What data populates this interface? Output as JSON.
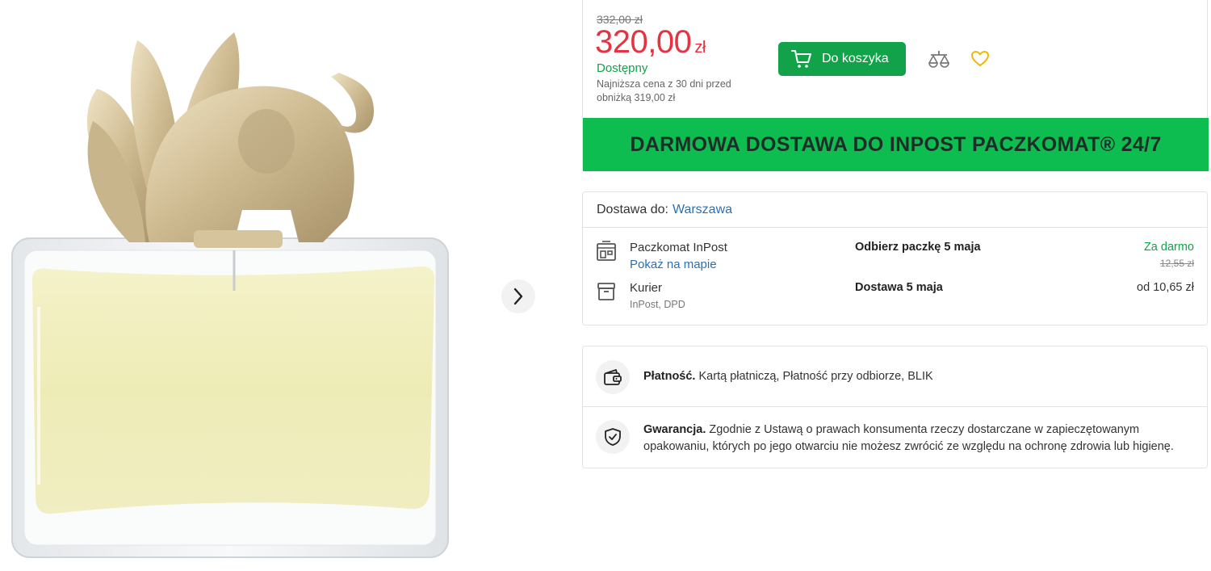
{
  "gallery": {
    "next_icon": "chevron-right-icon",
    "image_alt": "Kenzo Jungle L'Elephant perfume bottle"
  },
  "price": {
    "old_price": "332,00 zł",
    "current_value": "320,00",
    "currency": "zł",
    "availability": "Dostępny",
    "lowest_price_note": "Najniższa cena z 30 dni przed obniżką 319,00 zł",
    "colors": {
      "price": "#e63241",
      "accent": "#12a34a"
    }
  },
  "actions": {
    "cart_label": "Do koszyka",
    "cart_icon": "cart-icon",
    "compare_icon": "compare-icon",
    "favorite_icon": "heart-icon"
  },
  "promo": {
    "text": "DARMOWA DOSTAWA DO INPOST PACZKOMAT® 24/7",
    "color": "#0ebd4f"
  },
  "delivery": {
    "label": "Dostawa do:",
    "city": "Warszawa",
    "methods": [
      {
        "icon": "parcel-locker-icon",
        "name": "Paczkomat InPost",
        "link": "Pokaż na mapie",
        "when": "Odbierz paczkę 5 maja",
        "cost": "Za darmo",
        "old_cost": "12,55 zł"
      },
      {
        "icon": "courier-box-icon",
        "name": "Kurier",
        "sub": "InPost, DPD",
        "when": "Dostawa 5 maja",
        "cost": "od 10,65 zł"
      }
    ]
  },
  "info": {
    "payment": {
      "icon": "wallet-icon",
      "title": "Płatność.",
      "text": "Kartą płatniczą, Płatność przy odbiorze, BLIK"
    },
    "guarantee": {
      "icon": "shield-check-icon",
      "title": "Gwarancja.",
      "text": "Zgodnie z Ustawą o prawach konsumenta rzeczy dostarczane w zapieczętowanym opakowaniu, których po jego otwarciu nie możesz zwrócić ze względu na ochronę zdrowia lub higienę."
    }
  }
}
